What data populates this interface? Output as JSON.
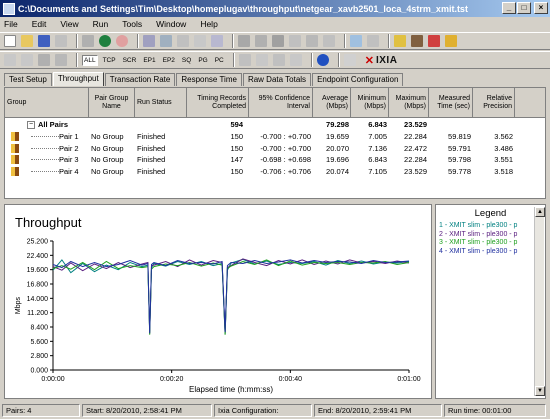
{
  "window": {
    "title": "C:\\Documents and Settings\\Tim\\Desktop\\homeplugav\\throughput\\netgear_xavb2501_loca_4strm_xmit.tst",
    "minimize": "_",
    "maximize": "□",
    "close": "×"
  },
  "menu": [
    "File",
    "Edit",
    "View",
    "Run",
    "Tools",
    "Window",
    "Help"
  ],
  "filters": [
    "ALL",
    "TCP",
    "SCR",
    "EP1",
    "EP2",
    "SQ",
    "PG",
    "PC"
  ],
  "brand": "IXIA",
  "tabs": [
    "Test Setup",
    "Throughput",
    "Transaction Rate",
    "Response Time",
    "Raw Data Totals",
    "Endpoint Configuration"
  ],
  "active_tab": 1,
  "grid": {
    "headers": [
      "Group",
      "Pair Group Name",
      "Run Status",
      "Timing Records Completed",
      "95% Confidence Interval",
      "Average (Mbps)",
      "Minimum (Mbps)",
      "Maximum (Mbps)",
      "Measured Time (sec)",
      "Relative Precision"
    ],
    "all_pairs": {
      "label": "All Pairs",
      "records": "594",
      "average": "79.298",
      "minimum": "6.843",
      "maximum": "23.529"
    },
    "rows": [
      {
        "pair": "Pair 1",
        "group": "No Group",
        "status": "Finished",
        "records": "150",
        "ci": "-0.700 : +0.700",
        "avg": "19.659",
        "min": "7.005",
        "max": "22.284",
        "time": "59.819",
        "prec": "3.562"
      },
      {
        "pair": "Pair 2",
        "group": "No Group",
        "status": "Finished",
        "records": "150",
        "ci": "-0.700 : +0.700",
        "avg": "20.070",
        "min": "7.136",
        "max": "22.472",
        "time": "59.791",
        "prec": "3.486"
      },
      {
        "pair": "Pair 3",
        "group": "No Group",
        "status": "Finished",
        "records": "147",
        "ci": "-0.698 : +0.698",
        "avg": "19.696",
        "min": "6.843",
        "max": "22.284",
        "time": "59.798",
        "prec": "3.551"
      },
      {
        "pair": "Pair 4",
        "group": "No Group",
        "status": "Finished",
        "records": "150",
        "ci": "-0.706 : +0.706",
        "avg": "20.074",
        "min": "7.105",
        "max": "23.529",
        "time": "59.778",
        "prec": "3.518"
      }
    ]
  },
  "chart_data": {
    "type": "line",
    "title": "Throughput",
    "xlabel": "Elapsed time (h:mm:ss)",
    "ylabel": "Mbps",
    "xlim": [
      0,
      60
    ],
    "ylim": [
      0,
      25.2
    ],
    "yticks": [
      "0.000",
      "2.800",
      "5.600",
      "8.400",
      "11.200",
      "14.000",
      "16.800",
      "19.600",
      "22.400",
      "25.200"
    ],
    "xticks": [
      "0:00:00",
      "0:00:20",
      "0:00:40",
      "0:01:00"
    ],
    "grid": false,
    "legend_position": "right",
    "series": [
      {
        "name": "1 - XMIT",
        "color": "#008080",
        "x": [
          0,
          1.5,
          3,
          5,
          7,
          9,
          11,
          13,
          15,
          16,
          16.3,
          16.6,
          17,
          19,
          21,
          23,
          25,
          27,
          28.5,
          29,
          29.4,
          30,
          32,
          34,
          36,
          38,
          40,
          42,
          44,
          46,
          48,
          50,
          52,
          54,
          56,
          58,
          60
        ],
        "y": [
          19.5,
          21.5,
          19,
          20.8,
          19.2,
          20.5,
          19.6,
          21,
          20.2,
          20.5,
          7.5,
          20,
          20.8,
          20.3,
          21.2,
          20.6,
          21.2,
          20.4,
          20.8,
          7,
          19.5,
          20.9,
          21.6,
          20.7,
          21.3,
          20.6,
          21,
          20.8,
          21.2,
          20.5,
          21.4,
          20.8,
          21.3,
          20.7,
          21.1,
          20.9,
          21.2
        ]
      },
      {
        "name": "2 - XMIT",
        "color": "#5a2080",
        "x": [
          0,
          1.5,
          3,
          5,
          7,
          9,
          11,
          13,
          15,
          16,
          16.3,
          16.6,
          17,
          19,
          21,
          23,
          25,
          27,
          28.5,
          29,
          29.4,
          30,
          32,
          34,
          36,
          38,
          40,
          42,
          44,
          46,
          48,
          50,
          52,
          54,
          56,
          58,
          60
        ],
        "y": [
          20.2,
          19.5,
          20.9,
          19.4,
          20.7,
          19.8,
          21,
          20,
          20.7,
          21,
          7.1,
          20.4,
          20.5,
          21.2,
          20.2,
          21.5,
          20.5,
          21.4,
          21,
          7.2,
          20,
          20.4,
          21.7,
          21,
          20.4,
          21.4,
          20.7,
          21.5,
          20.6,
          21.3,
          20.7,
          21.5,
          20.9,
          21.2,
          20.8,
          21.3,
          20.9
        ]
      },
      {
        "name": "3 - XMIT",
        "color": "#20a020",
        "x": [
          0,
          1.5,
          3,
          5,
          7,
          9,
          11,
          13,
          15,
          16,
          16.3,
          16.6,
          17,
          19,
          21,
          23,
          25,
          27,
          28.5,
          29,
          29.4,
          30,
          32,
          34,
          36,
          38,
          40,
          42,
          44,
          46,
          48,
          50,
          52,
          54,
          56,
          58,
          60
        ],
        "y": [
          19.8,
          20.4,
          19.7,
          21,
          19.6,
          21.2,
          19.8,
          20.4,
          20,
          20.2,
          6.9,
          19.7,
          20.2,
          20.7,
          20.4,
          21,
          20.3,
          20.9,
          20.5,
          6.9,
          19.8,
          20.3,
          21.2,
          20.6,
          21.5,
          20.4,
          21.3,
          20.5,
          21,
          20.8,
          21,
          20.6,
          21,
          20.9,
          21.2,
          20.6,
          21
        ]
      },
      {
        "name": "4 - XMIT",
        "color": "#2030a0",
        "x": [
          0,
          1.5,
          3,
          5,
          7,
          9,
          11,
          13,
          15,
          16,
          16.3,
          16.6,
          17,
          19,
          21,
          23,
          25,
          27,
          28.5,
          29,
          29.4,
          30,
          32,
          34,
          36,
          38,
          40,
          42,
          44,
          46,
          48,
          50,
          52,
          54,
          56,
          58,
          60
        ],
        "y": [
          20.6,
          20,
          21.2,
          20.2,
          21,
          20.2,
          20.6,
          21.4,
          20.5,
          20.8,
          7.2,
          20.6,
          21,
          20.4,
          21.4,
          20.8,
          21,
          20.7,
          21.2,
          7.4,
          20.4,
          21,
          20.8,
          21.4,
          20.8,
          21.1,
          21.5,
          20.9,
          21.4,
          21,
          21.2,
          21.1,
          20.8,
          21.4,
          21,
          21.1,
          21.3
        ]
      }
    ]
  },
  "legend": {
    "title": "Legend",
    "items": [
      {
        "text": "1 - XMIT  slim - ple300 - p",
        "color": "#008080"
      },
      {
        "text": "2 - XMIT  slim - ple300 - p",
        "color": "#5a2080"
      },
      {
        "text": "3 - XMIT  slim - ple300 - p",
        "color": "#20a020"
      },
      {
        "text": "4 - XMIT  slim - ple300 - p",
        "color": "#2030a0"
      }
    ]
  },
  "status": {
    "pairs": "Pairs: 4",
    "start": "Start: 8/20/2010, 2:58:41 PM",
    "ixia": "Ixia Configuration:",
    "end": "End: 8/20/2010, 2:59:41 PM",
    "runtime": "Run time: 00:01:00"
  }
}
